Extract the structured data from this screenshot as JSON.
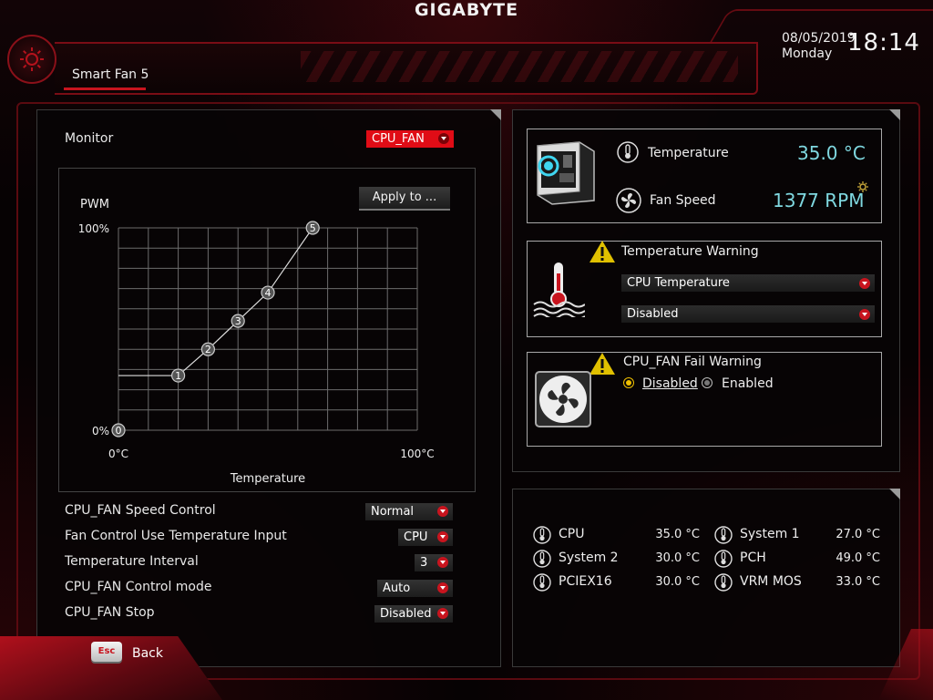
{
  "header": {
    "brand": "GIGABYTE",
    "tab": "Smart Fan 5",
    "date": "08/05/2019",
    "day": "Monday",
    "time": "18:14"
  },
  "left": {
    "monitor_label": "Monitor",
    "monitor_value": "CPU_FAN",
    "apply_button": "Apply to ...",
    "settings": [
      {
        "label": "CPU_FAN Speed Control",
        "value": "Normal"
      },
      {
        "label": "Fan Control Use Temperature Input",
        "value": "CPU"
      },
      {
        "label": "Temperature Interval",
        "value": "3"
      },
      {
        "label": "CPU_FAN Control mode",
        "value": "Auto"
      },
      {
        "label": "CPU_FAN Stop",
        "value": "Disabled"
      }
    ]
  },
  "chart_data": {
    "type": "line",
    "ylabel": "PWM",
    "xlabel": "Temperature",
    "x_tick_labels": [
      "0°C",
      "100°C"
    ],
    "y_tick_labels": [
      "0%",
      "100%"
    ],
    "xlim": [
      0,
      100
    ],
    "ylim": [
      0,
      100
    ],
    "grid": true,
    "points": [
      {
        "label": "0",
        "x": 0,
        "y": 0
      },
      {
        "label": "1",
        "x": 20,
        "y": 27
      },
      {
        "label": "2",
        "x": 30,
        "y": 40
      },
      {
        "label": "3",
        "x": 40,
        "y": 54
      },
      {
        "label": "4",
        "x": 50,
        "y": 68
      },
      {
        "label": "5",
        "x": 65,
        "y": 100
      }
    ],
    "flat_start": {
      "x": 0,
      "y": 27
    }
  },
  "monitor": {
    "temperature_label": "Temperature",
    "temperature_value": "35.0 °C",
    "fan_speed_label": "Fan Speed",
    "fan_speed_value": "1377 RPM"
  },
  "temp_warning": {
    "title": "Temperature Warning",
    "source": "CPU Temperature",
    "value": "Disabled"
  },
  "fail_warning": {
    "title": "CPU_FAN Fail Warning",
    "option_disabled": "Disabled",
    "option_enabled": "Enabled",
    "selected": "Disabled"
  },
  "temperatures": [
    {
      "name": "CPU",
      "value": "35.0 °C"
    },
    {
      "name": "System 1",
      "value": "27.0 °C"
    },
    {
      "name": "System 2",
      "value": "30.0 °C"
    },
    {
      "name": "PCH",
      "value": "49.0 °C"
    },
    {
      "name": "PCIEX16",
      "value": "30.0 °C"
    },
    {
      "name": "VRM MOS",
      "value": "33.0 °C"
    }
  ],
  "footer": {
    "esc_key": "Esc",
    "back_label": "Back"
  },
  "colors": {
    "accent": "#c8141e",
    "cyan": "#7fd8e0",
    "warning": "#f0c000"
  }
}
